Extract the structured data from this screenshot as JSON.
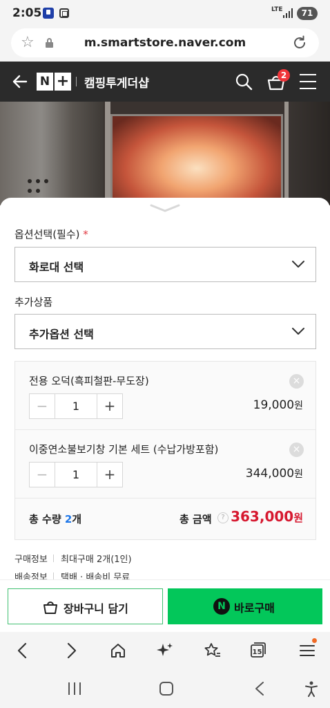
{
  "status_bar": {
    "time": "2:05",
    "network": "LTE",
    "battery": "71"
  },
  "browser": {
    "url": "m.smartstore.naver.com"
  },
  "store_header": {
    "logo_n": "N",
    "logo_plus": "+",
    "store_name": "캠핑투게더샵",
    "cart_count": "2"
  },
  "options": {
    "required_label": "옵션선택(필수)",
    "required_mark": "*",
    "required_select_value": "화로대 선택",
    "addon_label": "추가상품",
    "addon_select_value": "추가옵션 선택"
  },
  "selected_items": [
    {
      "name": "전용 오덕(흑피철판-무도장)",
      "qty": "1",
      "price": "19,000",
      "unit": "원"
    },
    {
      "name": "이중연소불보기창 기본 세트 (수납가방포함)",
      "qty": "1",
      "price": "344,000",
      "unit": "원"
    }
  ],
  "stepper": {
    "minus": "−",
    "plus": "+"
  },
  "remove_symbol": "×",
  "total": {
    "qty_label": "총 수량",
    "qty_value": "2",
    "qty_unit": "개",
    "amount_label": "총 금액",
    "help_symbol": "?",
    "amount_value": "363,000",
    "amount_unit": "원"
  },
  "info": [
    {
      "key": "구매정보",
      "value": "최대구매 2개(1인)"
    },
    {
      "key": "배송정보",
      "value": "택배 · 배송비 무료"
    }
  ],
  "actions": {
    "cart_label": "장바구니 담기",
    "buy_icon": "N",
    "buy_label": "바로구매"
  },
  "browser_nav": {
    "tab_count": "15"
  },
  "colors": {
    "header_bg": "#2b2b2b",
    "buy_green": "#03c75a",
    "price_red": "#d6182f",
    "qty_blue": "#1e77e8",
    "badge_red": "#f0353a"
  }
}
